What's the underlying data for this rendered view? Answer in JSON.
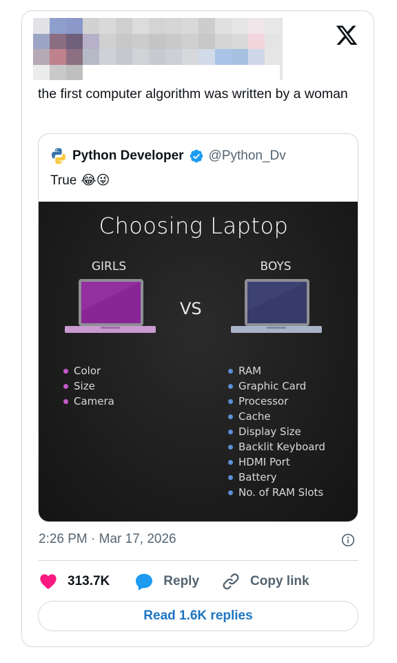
{
  "tweet": {
    "text": "the first computer algorithm was written by a woman",
    "timestamp": "2:26 PM · Mar 17, 2026"
  },
  "quote": {
    "name": "Python Developer",
    "handle": "@Python_Dv",
    "text": "True",
    "emojis": [
      "😂",
      "😜"
    ]
  },
  "image": {
    "title": "Choosing Laptop",
    "left_heading": "GIRLS",
    "right_heading": "BOYS",
    "vs": "VS",
    "girls_items": [
      "Color",
      "Size",
      "Camera"
    ],
    "boys_items": [
      "RAM",
      "Graphic Card",
      "Processor",
      "Cache",
      "Display Size",
      "Backlit Keyboard",
      "HDMI Port",
      "Battery",
      "No. of RAM Slots"
    ],
    "girls_color": "#c45bc9",
    "boys_color": "#5b8fd6"
  },
  "actions": {
    "like_count": "313.7K",
    "reply_label": "Reply",
    "copy_link_label": "Copy link",
    "read_replies_label": "Read 1.6K replies"
  },
  "colors": {
    "heart": "#f91880",
    "accent_blue": "#1d9bf0",
    "link_blue": "#1d76c2",
    "muted": "#536471",
    "border": "#cfd9de"
  },
  "icons": {
    "close": "x-logo-icon",
    "verified": "verified-badge-icon",
    "info": "info-icon",
    "like": "heart-icon",
    "reply": "reply-bubble-icon",
    "copy": "link-icon"
  }
}
